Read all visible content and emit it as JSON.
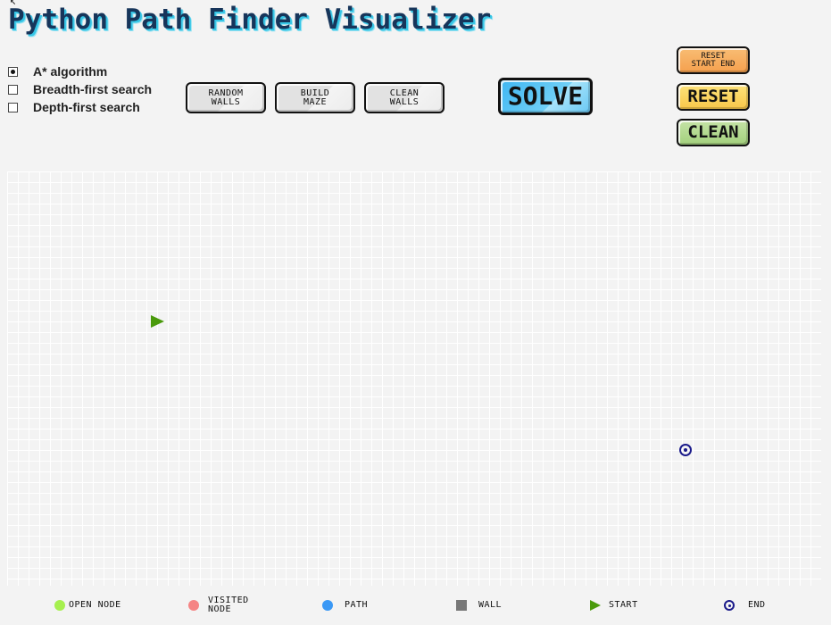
{
  "app": {
    "title": "Python Path Finder Visualizer"
  },
  "algorithms": [
    {
      "label": "A* algorithm",
      "selected": true
    },
    {
      "label": "Breadth-first search",
      "selected": false
    },
    {
      "label": "Depth-first search",
      "selected": false
    }
  ],
  "buttons": {
    "random_walls": {
      "line1": "RANDOM",
      "line2": "WALLS"
    },
    "build_maze": {
      "line1": "BUILD",
      "line2": "MAZE"
    },
    "clean_walls": {
      "line1": "CLEAN",
      "line2": "WALLS"
    },
    "solve": "SOLVE",
    "reset_start_end": {
      "line1": "RESET",
      "line2": "START END"
    },
    "reset": "RESET",
    "clean": "CLEAN"
  },
  "legend": {
    "open_node": "OPEN NODE",
    "visited_node_line1": "VISITED",
    "visited_node_line2": "NODE",
    "path": "PATH",
    "wall": "WALL",
    "start": "START",
    "end": "END"
  },
  "colors": {
    "open_node": "#a6f04f",
    "visited_node": "#f58484",
    "path": "#3a98f5",
    "wall": "#777777",
    "start": "#4a9a0c",
    "end": "#1a1a8a"
  },
  "icons": {
    "start_marker": "play-triangle-icon",
    "end_marker": "target-circle-icon"
  }
}
